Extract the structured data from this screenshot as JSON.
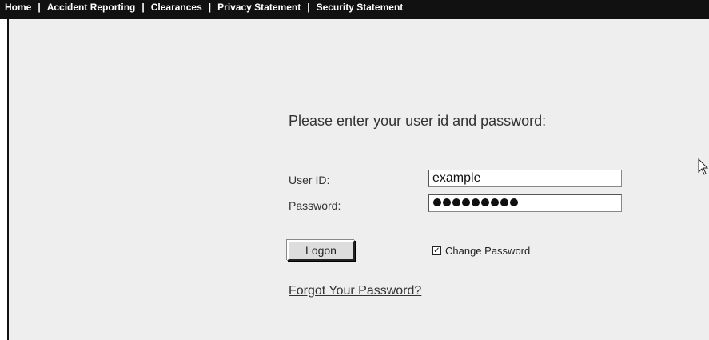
{
  "nav": {
    "items": [
      {
        "label": "Home"
      },
      {
        "label": "Accident Reporting"
      },
      {
        "label": "Clearances"
      },
      {
        "label": "Privacy Statement"
      },
      {
        "label": "Security Statement"
      }
    ],
    "separator": "|"
  },
  "login": {
    "prompt": "Please enter your user id and password:",
    "user_id_label": "User ID:",
    "user_id_value": "example",
    "password_label": "Password:",
    "password_masked": "●●●●●●●●●",
    "logon_label": "Logon",
    "change_password_label": "Change Password",
    "change_password_checked": true,
    "forgot_label": "Forgot Your Password?"
  },
  "colors": {
    "topbar": "#111111",
    "content_bg": "#eeeeee",
    "text": "#333333"
  }
}
